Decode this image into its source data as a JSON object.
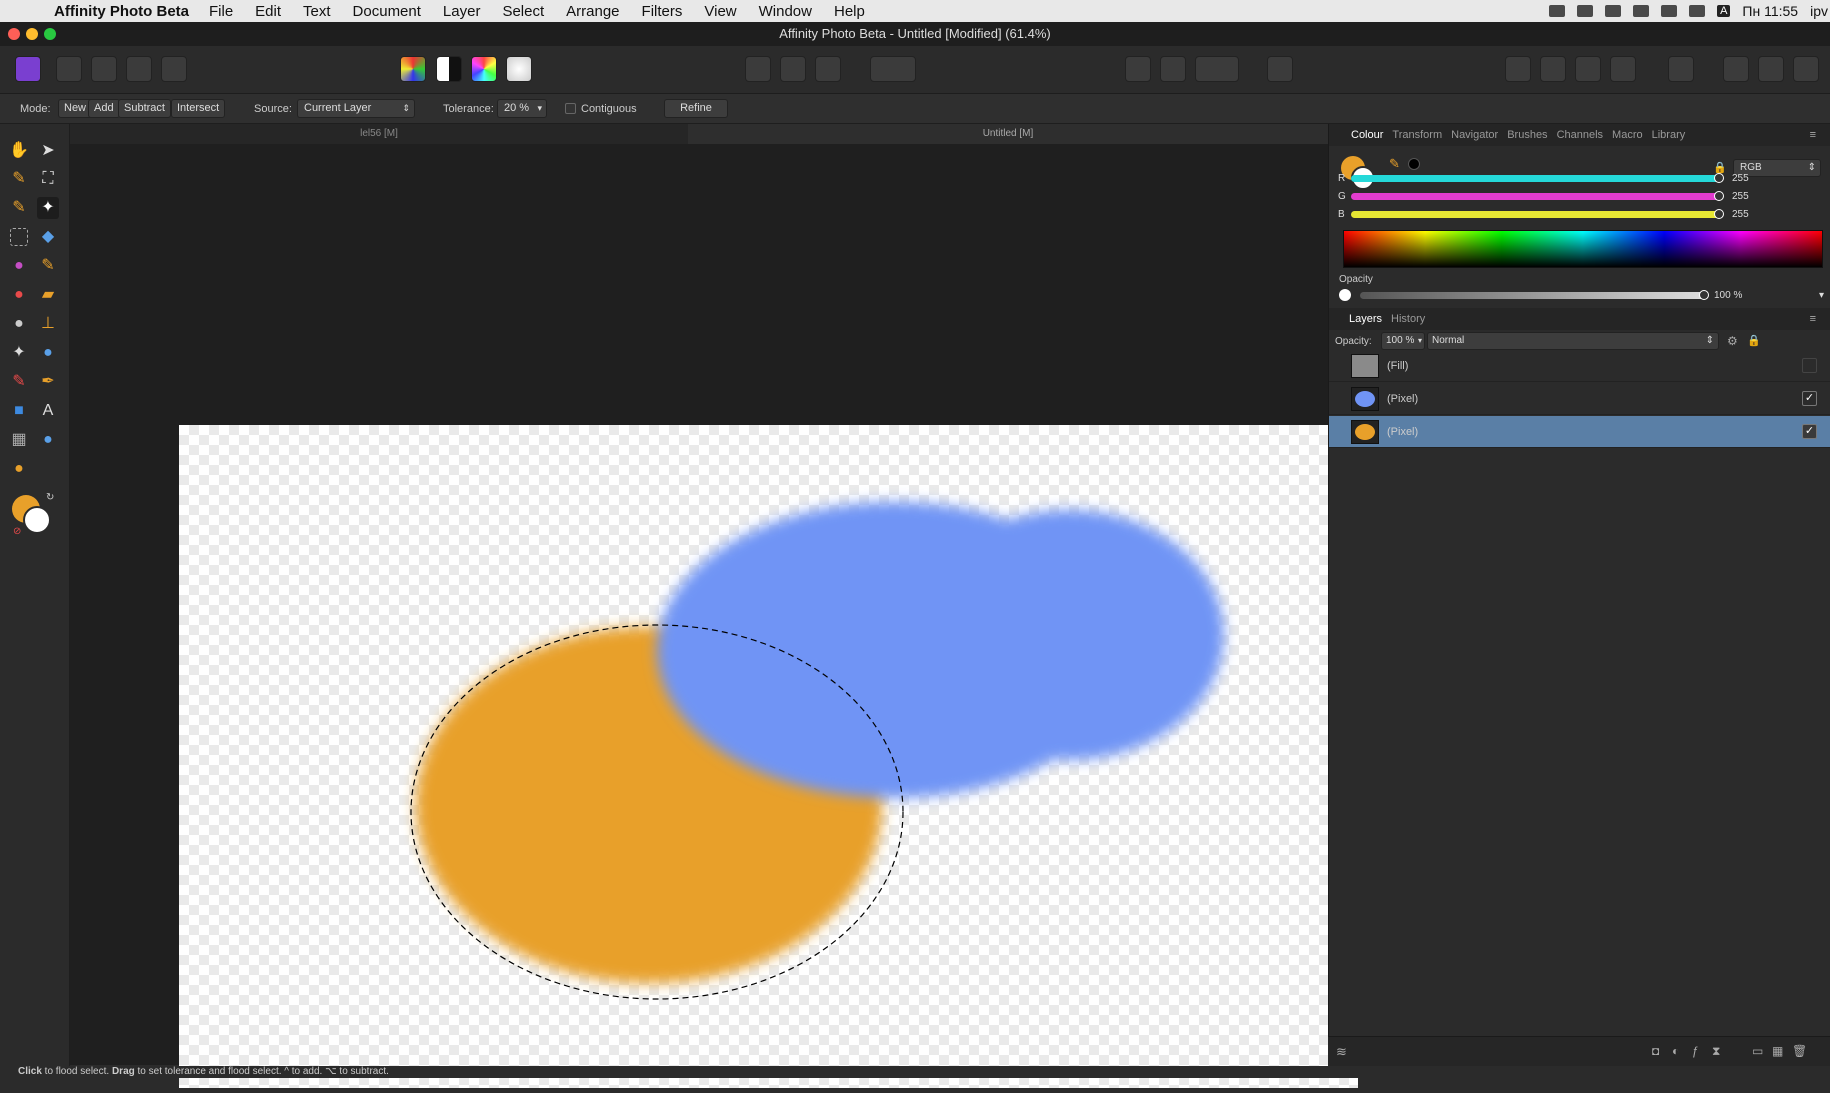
{
  "menubar": {
    "app_name": "Affinity Photo Beta",
    "items": [
      "File",
      "Edit",
      "Text",
      "Document",
      "Layer",
      "Select",
      "Arrange",
      "Filters",
      "View",
      "Window",
      "Help"
    ],
    "clock": "Пн 11:55",
    "user": "ipv"
  },
  "window": {
    "title": "Affinity Photo Beta - Untitled [Modified] (61.4%)"
  },
  "context_bar": {
    "mode_label": "Mode:",
    "mode_buttons": [
      "New",
      "Add",
      "Subtract",
      "Intersect"
    ],
    "source_label": "Source:",
    "source_value": "Current Layer",
    "tolerance_label": "Tolerance:",
    "tolerance_value": "20 %",
    "contiguous_label": "Contiguous",
    "refine_label": "Refine"
  },
  "doc_tabs": [
    "lel56 [M]",
    "Untitled [M]"
  ],
  "colour_panel": {
    "tabs": [
      "Colour",
      "Transform",
      "Navigator",
      "Brushes",
      "Channels",
      "Macro",
      "Library"
    ],
    "model": "RGB",
    "channels": [
      {
        "label": "R",
        "value": "255",
        "color": "#25d9d9"
      },
      {
        "label": "G",
        "value": "255",
        "color": "#e33ccf"
      },
      {
        "label": "B",
        "value": "255",
        "color": "#e6e633"
      }
    ],
    "opacity_label": "Opacity",
    "opacity_value": "100 %"
  },
  "layers_panel": {
    "tabs": [
      "Layers",
      "History"
    ],
    "opacity_label": "Opacity:",
    "opacity_value": "100 %",
    "blend_mode": "Normal",
    "layers": [
      {
        "name": "(Fill)",
        "visible": false,
        "selected": false,
        "thumb": "#8a8a8a"
      },
      {
        "name": "(Pixel)",
        "visible": true,
        "selected": false,
        "thumb": "#7094f5"
      },
      {
        "name": "(Pixel)",
        "visible": true,
        "selected": true,
        "thumb": "#e8a02a"
      }
    ]
  },
  "canvas": {
    "orange": "#e8a02a",
    "blue": "#7094f5"
  },
  "status": {
    "parts": [
      "Click",
      " to flood select. ",
      "Drag",
      " to set tolerance and flood select. ^ to add. ⌥ to subtract."
    ]
  }
}
